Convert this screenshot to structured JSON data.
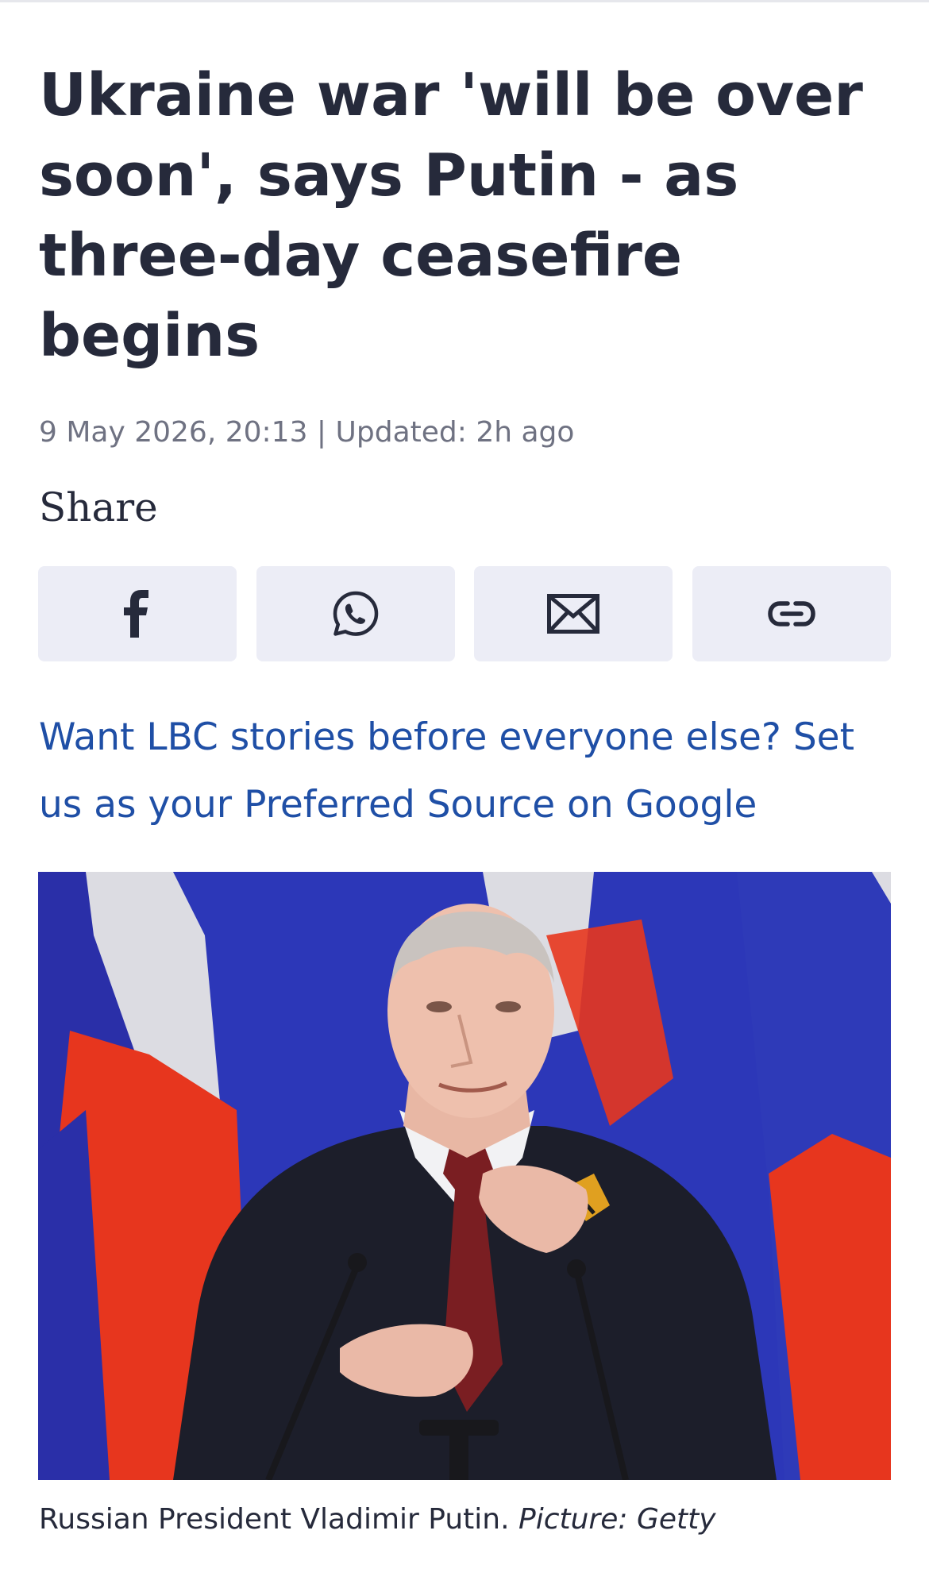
{
  "article": {
    "headline": "Ukraine war 'will be over soon', says Putin - as three-day ceasefire begins",
    "date": "9 May 2026, 20:13",
    "separator": "|",
    "updated": "Updated: 2h ago"
  },
  "share": {
    "label": "Share",
    "buttons": [
      {
        "icon": "facebook-icon"
      },
      {
        "icon": "whatsapp-icon"
      },
      {
        "icon": "email-icon"
      },
      {
        "icon": "link-icon"
      }
    ]
  },
  "promo": {
    "text": "Want LBC stories before everyone else? Set us as your Preferred Source on Google"
  },
  "photo": {
    "caption": "Russian President Vladimir Putin.",
    "credit": "Picture: Getty"
  },
  "colors": {
    "headline": "#262a3b",
    "meta": "#6f7282",
    "link": "#1f4fa6",
    "share_bg": "#ecedf6",
    "flag_blue": "#2c37b8",
    "flag_red": "#e7361e",
    "flag_white": "#d9d9de"
  }
}
